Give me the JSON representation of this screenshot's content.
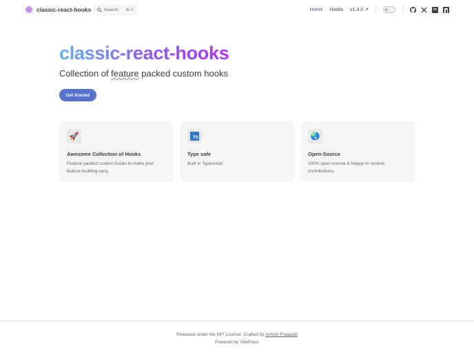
{
  "nav": {
    "brand": "classic-react-hooks",
    "search_label": "Search",
    "search_kbd": "⌘ K",
    "links": [
      {
        "label": "Home"
      },
      {
        "label": "Hooks"
      },
      {
        "label": "v1.4.0 ↗"
      }
    ],
    "social": [
      "github-icon",
      "x-icon",
      "linkedin-icon",
      "npm-icon"
    ]
  },
  "hero": {
    "title": "classic-react-hooks",
    "tagline_pre": "Collection of ",
    "tagline_word": "feature",
    "tagline_post": " packed custom hooks",
    "cta": "Get Started"
  },
  "features": [
    {
      "icon": "🚀",
      "title": "Awesome Collection of Hooks",
      "desc": "Feature packed custom hooks to make your feature building easy."
    },
    {
      "icon": "TS",
      "title": "Type safe",
      "desc": "Built in Typescript."
    },
    {
      "icon": "🌏",
      "title": "Open-Source",
      "desc": "100% open-source & Happy to recieve contributions."
    }
  ],
  "footer": {
    "message": "Released under the MIT License. Crafted by ",
    "author": "Ashish Prajapati",
    "powered": "Powered by VitePress"
  },
  "colors": {
    "brand": "#5672cd",
    "active_link": "#3451b2"
  }
}
